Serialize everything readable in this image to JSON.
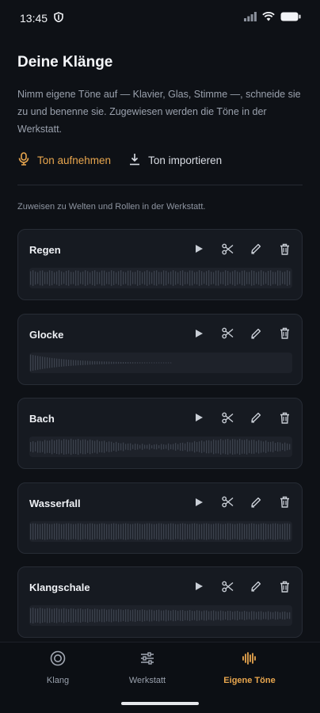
{
  "status": {
    "time": "13:45"
  },
  "header": {
    "title": "Deine Klänge",
    "description": "Nimm eigene Töne auf — Klavier, Glas, Stimme —, schneide sie zu und benenne sie. Zugewiesen werden die Töne in der Werkstatt."
  },
  "actions": {
    "record_label": "Ton aufnehmen",
    "import_label": "Ton importieren"
  },
  "hint": "Zuweisen zu Welten und Rollen in der Werkstatt.",
  "sounds": [
    {
      "name": "Regen",
      "shape": "steady"
    },
    {
      "name": "Glocke",
      "shape": "decay"
    },
    {
      "name": "Bach",
      "shape": "wave"
    },
    {
      "name": "Wasserfall",
      "shape": "dense"
    },
    {
      "name": "Klangschale",
      "shape": "swell"
    }
  ],
  "tabs": [
    {
      "label": "Klang",
      "icon": "target-icon",
      "active": false
    },
    {
      "label": "Werkstatt",
      "icon": "sliders-icon",
      "active": false
    },
    {
      "label": "Eigene Töne",
      "icon": "waveform-icon",
      "active": true
    }
  ],
  "colors": {
    "accent": "#e8a64e",
    "background": "#0e1116",
    "card": "#161a21"
  }
}
